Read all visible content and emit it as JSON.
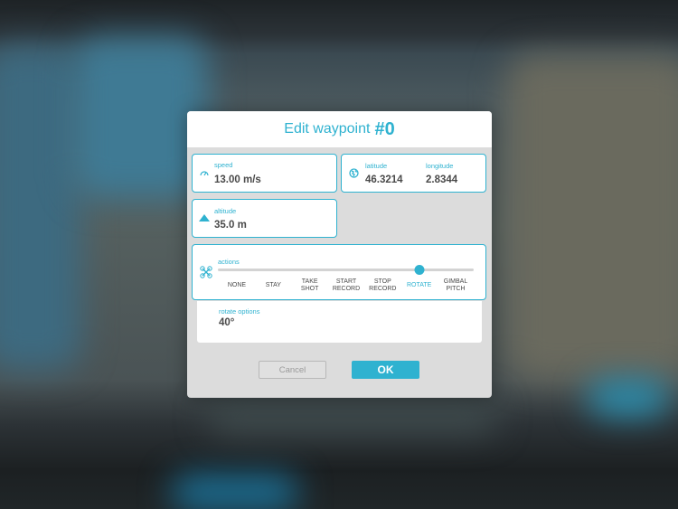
{
  "dialog": {
    "title": "Edit waypoint",
    "number": "#0"
  },
  "speed": {
    "label": "speed",
    "value": "13.00 m/s",
    "icon": "speedometer-icon"
  },
  "position": {
    "latitude_label": "latitude",
    "latitude_value": "46.3214",
    "longitude_label": "longitude",
    "longitude_value": "2.8344",
    "icon": "globe-icon"
  },
  "altitude": {
    "label": "altitude",
    "value": "35.0 m",
    "icon": "mountain-icon"
  },
  "actions": {
    "label": "actions",
    "icon": "drone-icon",
    "options": [
      {
        "line1": "NONE",
        "line2": ""
      },
      {
        "line1": "STAY",
        "line2": ""
      },
      {
        "line1": "TAKE",
        "line2": "SHOT"
      },
      {
        "line1": "START",
        "line2": "RECORD"
      },
      {
        "line1": "STOP",
        "line2": "RECORD"
      },
      {
        "line1": "ROTATE",
        "line2": ""
      },
      {
        "line1": "GIMBAL",
        "line2": "PITCH"
      }
    ],
    "selected_index": 5
  },
  "rotate_options": {
    "label": "rotate options",
    "value": "40°"
  },
  "buttons": {
    "cancel": "Cancel",
    "ok": "OK"
  },
  "colors": {
    "accent": "#2fb2d0",
    "text": "#4a4a4a",
    "dialog_bg": "#dcdcdc"
  }
}
